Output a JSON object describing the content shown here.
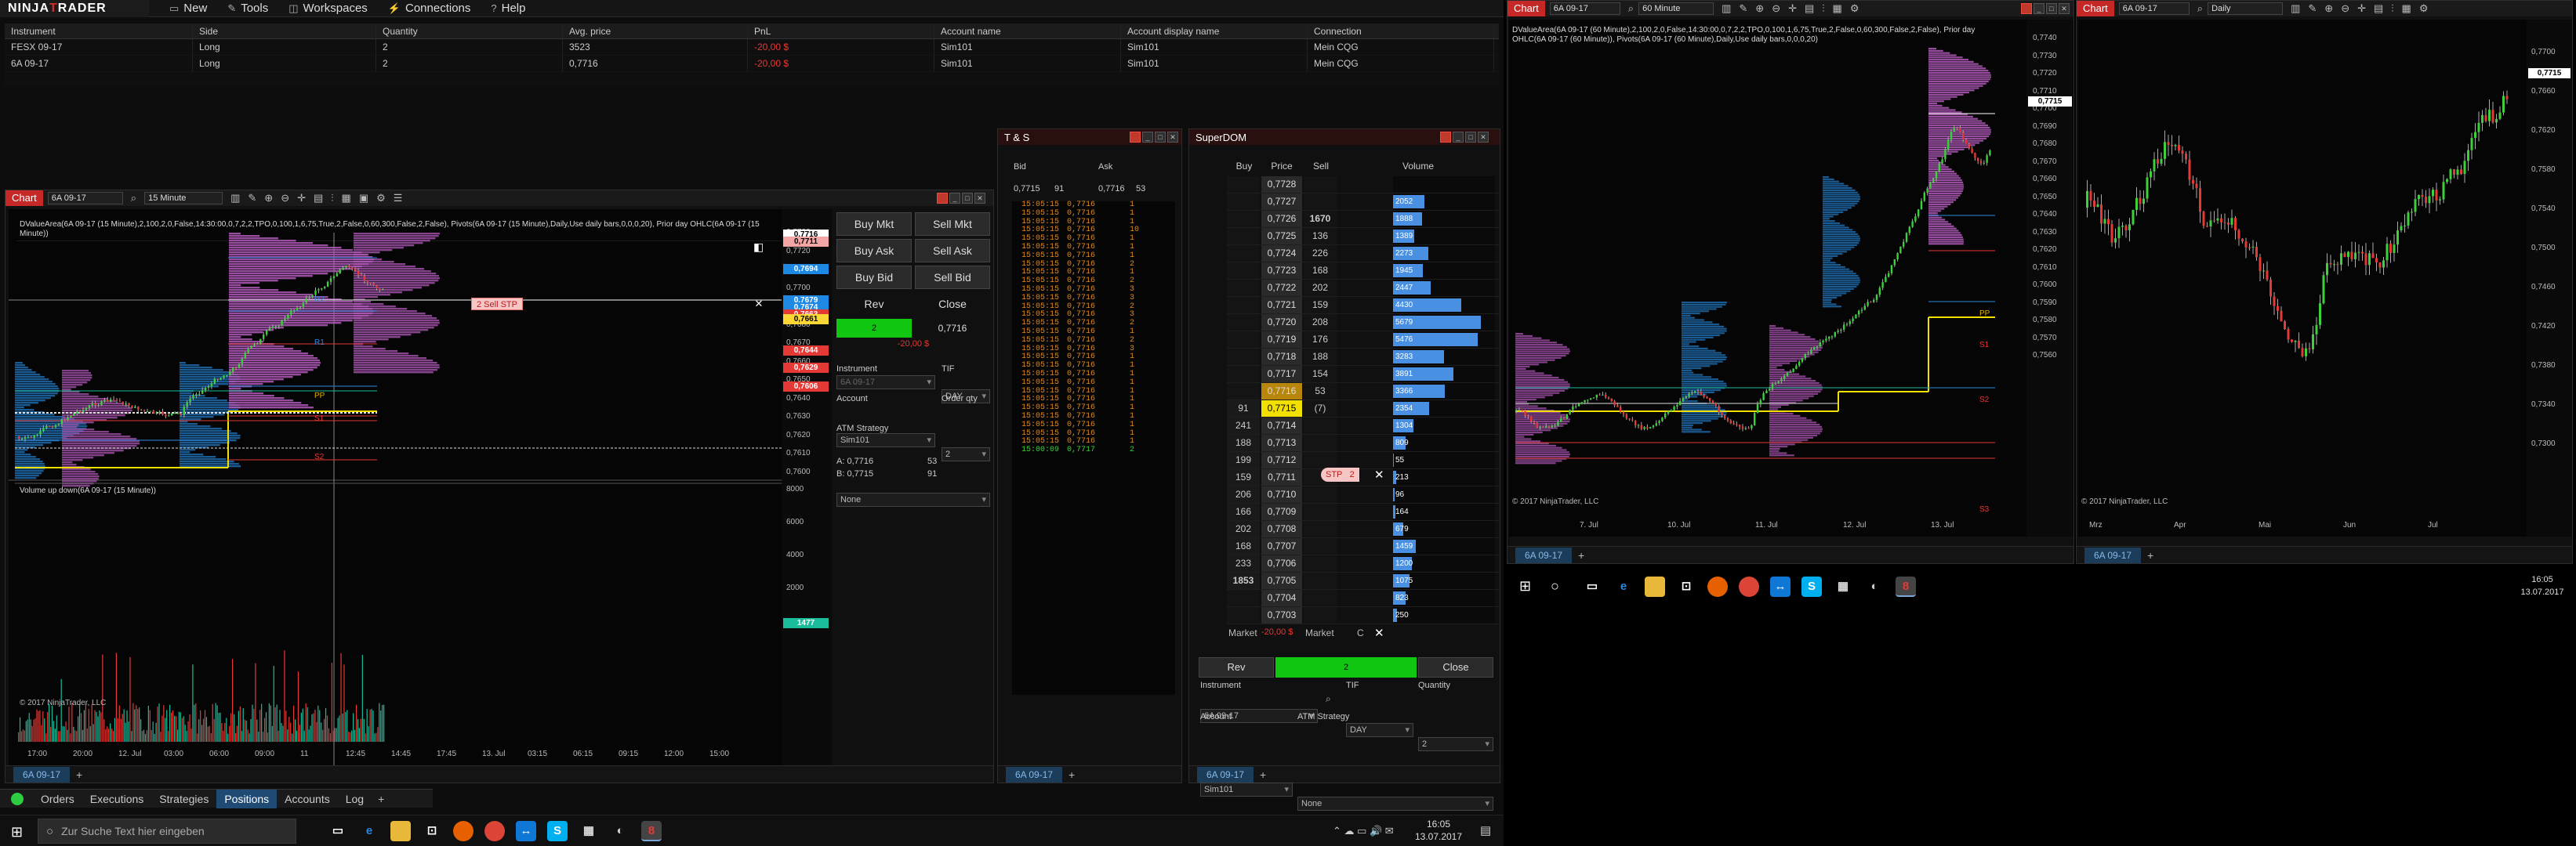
{
  "app": {
    "brand": "NINJATRADER"
  },
  "menu": [
    {
      "label": "New",
      "icon": "new-icon"
    },
    {
      "label": "Tools",
      "icon": "tools-icon"
    },
    {
      "label": "Workspaces",
      "icon": "workspaces-icon"
    },
    {
      "label": "Connections",
      "icon": "connections-icon"
    },
    {
      "label": "Help",
      "icon": "help-icon"
    }
  ],
  "positions": {
    "headers": [
      "Instrument",
      "Side",
      "Quantity",
      "Avg. price",
      "PnL",
      "Account name",
      "Account display name",
      "Connection"
    ],
    "rows": [
      [
        "FESX 09-17",
        "Long",
        "2",
        "3523",
        "-20,00 $",
        "Sim101",
        "Sim101",
        "Mein CQG"
      ],
      [
        "6A 09-17",
        "Long",
        "2",
        "0,7716",
        "-20,00 $",
        "Sim101",
        "Sim101",
        "Mein CQG"
      ]
    ]
  },
  "chart1": {
    "tag": "Chart",
    "instrument": "6A 09-17",
    "interval": "15 Minute",
    "indicator_text": "DValueArea(6A 09-17 (15 Minute),2,100,2,0,False,14:30:00,0,7,2,2,TPO,0,100,1,6,75,True,2,False,0,60,300,False,2,False), Pivots(6A 09-17 (15 Minute),Daily,Use daily bars,0,0,0,20), Prior day OHLC(6A 09-17 (15 Minute))",
    "volume_text": "Volume up down(6A 09-17 (15 Minute))",
    "copyright": "© 2017 NinjaTrader, LLC",
    "order_label": "2  Sell STP",
    "price_ticks": [
      "0,7730",
      "0,7720",
      "0,7710",
      "0,7700",
      "0,7690",
      "0,7680",
      "0,7670",
      "0,7660",
      "0,7650",
      "0,7640",
      "0,7630",
      "0,7620",
      "0,7610",
      "0,7600"
    ],
    "price_labels": [
      {
        "text": "0,7716",
        "color": "#ffffff",
        "fg": "#000000"
      },
      {
        "text": "0,7711",
        "color": "#f4a5a5",
        "fg": "#000000"
      },
      {
        "text": "0,7694",
        "color": "#1e88e5",
        "fg": "#ffffff"
      },
      {
        "text": "0,7679",
        "color": "#1e88e5",
        "fg": "#ffffff"
      },
      {
        "text": "0,7674",
        "color": "#1e88e5",
        "fg": "#ffffff"
      },
      {
        "text": "0,7663",
        "color": "#e53935",
        "fg": "#ffffff"
      },
      {
        "text": "0,7661",
        "color": "#fdd835",
        "fg": "#000000"
      },
      {
        "text": "0,7644",
        "color": "#e53935",
        "fg": "#ffffff"
      },
      {
        "text": "0,7629",
        "color": "#e53935",
        "fg": "#ffffff"
      },
      {
        "text": "0,7606",
        "color": "#e53935",
        "fg": "#ffffff"
      }
    ],
    "pivot_labels": [
      "R2",
      "R1",
      "PP",
      "S1",
      "S2"
    ],
    "vol_ticks": [
      "8000",
      "6000",
      "4000",
      "2000"
    ],
    "vol_label": "1477",
    "time_ticks": [
      "17:00",
      "20:00",
      "12. Jul",
      "03:00",
      "06:00",
      "09:00",
      "11",
      "12:45",
      "14:45",
      "17:45",
      "13. Jul",
      "03:15",
      "06:15",
      "09:15",
      "12:00",
      "15:00"
    ],
    "tab": "6A 09-17"
  },
  "chart_trader": {
    "buttons": [
      "Buy Mkt",
      "Sell Mkt",
      "Buy Ask",
      "Sell Ask",
      "Buy Bid",
      "Sell Bid",
      "Rev",
      "Close"
    ],
    "position_qty": "2",
    "position_price": "0,7716",
    "pnl": "-20,00 $",
    "instrument_label": "Instrument",
    "instrument": "6A 09-17",
    "tif_label": "TIF",
    "tif": "DAY",
    "account_label": "Account",
    "account": "Sim101",
    "qty_label": "Order qty",
    "qty": "2",
    "atm_label": "ATM Strategy",
    "atm": "None",
    "ask": "A: 0,7716",
    "ask_size": "53",
    "bid": "B: 0,7715",
    "bid_size": "91"
  },
  "ts": {
    "title": "T & S",
    "bid_label": "Bid",
    "ask_label": "Ask",
    "bid": "0,7715",
    "bid_size": "91",
    "ask": "0,7716",
    "ask_size": "53",
    "rows": [
      [
        "15:05:15",
        "0,7716",
        "1"
      ],
      [
        "15:05:15",
        "0,7716",
        "1"
      ],
      [
        "15:05:15",
        "0,7716",
        "1"
      ],
      [
        "15:05:15",
        "0,7716",
        "10"
      ],
      [
        "15:05:15",
        "0,7716",
        "1"
      ],
      [
        "15:05:15",
        "0,7716",
        "1"
      ],
      [
        "15:05:15",
        "0,7716",
        "1"
      ],
      [
        "15:05:15",
        "0,7716",
        "2"
      ],
      [
        "15:05:15",
        "0,7716",
        "1"
      ],
      [
        "15:05:15",
        "0,7716",
        "2"
      ],
      [
        "15:05:15",
        "0,7716",
        "3"
      ],
      [
        "15:05:15",
        "0,7716",
        "3"
      ],
      [
        "15:05:15",
        "0,7716",
        "2"
      ],
      [
        "15:05:15",
        "0,7716",
        "3"
      ],
      [
        "15:05:15",
        "0,7716",
        "2"
      ],
      [
        "15:05:15",
        "0,7716",
        "1"
      ],
      [
        "15:05:15",
        "0,7716",
        "2"
      ],
      [
        "15:05:15",
        "0,7716",
        "3"
      ],
      [
        "15:05:15",
        "0,7716",
        "1"
      ],
      [
        "15:05:15",
        "0,7716",
        "1"
      ],
      [
        "15:05:15",
        "0,7716",
        "1"
      ],
      [
        "15:05:15",
        "0,7716",
        "1"
      ],
      [
        "15:05:15",
        "0,7716",
        "1"
      ],
      [
        "15:05:15",
        "0,7716",
        "1"
      ],
      [
        "15:05:15",
        "0,7716",
        "1"
      ],
      [
        "15:05:15",
        "0,7716",
        "1"
      ],
      [
        "15:05:15",
        "0,7716",
        "1"
      ],
      [
        "15:05:15",
        "0,7716",
        "1"
      ],
      [
        "15:05:15",
        "0,7716",
        "1"
      ],
      [
        "15:00:09",
        "0,7717",
        "2"
      ]
    ],
    "tab": "6A 09-17"
  },
  "dom": {
    "title": "SuperDOM",
    "headers": [
      "Buy",
      "Price",
      "Sell",
      "Volume"
    ],
    "rows": [
      [
        "",
        "0,7728",
        "",
        ""
      ],
      [
        "",
        "0,7727",
        "",
        "2052"
      ],
      [
        "",
        "0,7726",
        "1670",
        "1888"
      ],
      [
        "",
        "0,7725",
        "136",
        "1389"
      ],
      [
        "",
        "0,7724",
        "226",
        "2273"
      ],
      [
        "",
        "0,7723",
        "168",
        "1945"
      ],
      [
        "",
        "0,7722",
        "202",
        "2447"
      ],
      [
        "",
        "0,7721",
        "159",
        "4430"
      ],
      [
        "",
        "0,7720",
        "208",
        "5679"
      ],
      [
        "",
        "0,7719",
        "176",
        "5476"
      ],
      [
        "",
        "0,7718",
        "188",
        "3283"
      ],
      [
        "",
        "0,7717",
        "154",
        "3891"
      ],
      [
        "",
        "0,7716",
        "53",
        "3366"
      ],
      [
        "91",
        "0,7715",
        "(7)",
        "2354"
      ],
      [
        "241",
        "0,7714",
        "",
        "1304"
      ],
      [
        "188",
        "0,7713",
        "",
        "809"
      ],
      [
        "199",
        "0,7712",
        "",
        "55"
      ],
      [
        "159",
        "0,7711",
        "",
        "213"
      ],
      [
        "206",
        "0,7710",
        "",
        "96"
      ],
      [
        "166",
        "0,7709",
        "",
        "164"
      ],
      [
        "202",
        "0,7708",
        "",
        "679"
      ],
      [
        "168",
        "0,7707",
        "",
        "1459"
      ],
      [
        "233",
        "0,7706",
        "",
        "1200"
      ],
      [
        "1853",
        "0,7705",
        "",
        "1075"
      ],
      [
        "",
        "0,7704",
        "",
        "823"
      ],
      [
        "",
        "0,7703",
        "",
        "250"
      ]
    ],
    "stop_label": "STP",
    "stop_qty": "2",
    "market_buy": "Market",
    "pnl": "-20,00 $",
    "market_sell": "Market",
    "c_label": "C",
    "rev": "Rev",
    "position": "2",
    "close": "Close",
    "instrument_label": "Instrument",
    "instrument": "6A 09-17",
    "tif_label": "TIF",
    "tif": "DAY",
    "qty_label": "Quantity",
    "qty": "2",
    "account_label": "Account",
    "account": "Sim101",
    "atm_label": "ATM Strategy",
    "atm": "None",
    "tab": "6A 09-17"
  },
  "bottom_tabs": [
    "Orders",
    "Executions",
    "Strategies",
    "Positions",
    "Accounts",
    "Log"
  ],
  "taskbar": {
    "search": "Zur Suche Text hier eingeben",
    "time": "16:05",
    "date": "13.07.2017"
  },
  "chart2": {
    "tag": "Chart",
    "instrument": "6A 09-17",
    "interval": "60 Minute",
    "indicator_text": "DValueArea(6A 09-17 (60 Minute),2,100,2,0,False,14:30:00,0,7,2,2,TPO,0,100,1,6,75,True,2,False,0,60,300,False,2,False), Prior day OHLC(6A 09-17 (60 Minute)), Pivots(6A 09-17 (60 Minute),Daily,Use daily bars,0,0,0,20)",
    "copyright": "© 2017 NinjaTrader, LLC",
    "price_ticks": [
      "0,7740",
      "0,7730",
      "0,7720",
      "0,7710",
      "0,7700",
      "0,7690",
      "0,7680",
      "0,7670",
      "0,7660",
      "0,7650",
      "0,7640",
      "0,7630",
      "0,7620",
      "0,7610",
      "0,7600",
      "0,7590",
      "0,7580",
      "0,7570",
      "0,7560"
    ],
    "price_label": "0,7715",
    "time_ticks": [
      "7. Jul",
      "10. Jul",
      "11. Jul",
      "12. Jul",
      "13. Jul"
    ],
    "pivot_labels": [
      "PP",
      "S1",
      "S2",
      "S3"
    ],
    "tab": "6A 09-17"
  },
  "chart3": {
    "tag": "Chart",
    "instrument": "6A 09-17",
    "interval": "Daily",
    "copyright": "© 2017 NinjaTrader, LLC",
    "price_ticks": [
      "0,7700",
      "0,7660",
      "0,7620",
      "0,7580",
      "0,7540",
      "0,7500",
      "0,7460",
      "0,7420",
      "0,7380",
      "0,7340",
      "0,7300"
    ],
    "price_label": "0,7715",
    "time_ticks": [
      "Mrz",
      "Apr",
      "Mai",
      "Jun",
      "Jul"
    ],
    "tab": "6A 09-17"
  },
  "taskbar2": {
    "time": "16:05",
    "date": "13.07.2017"
  }
}
